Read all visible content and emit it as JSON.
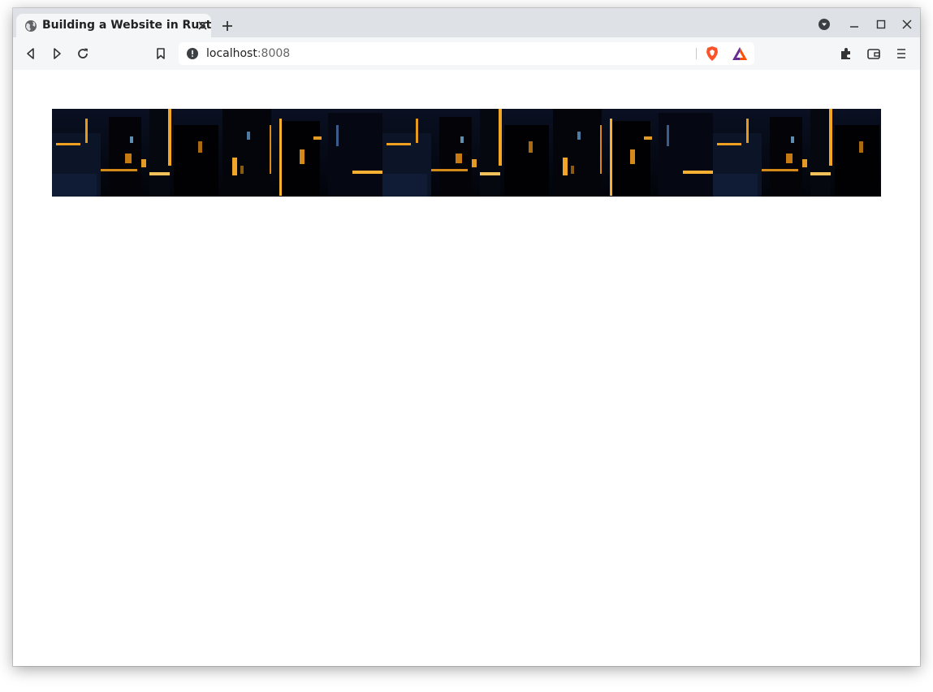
{
  "tab": {
    "title": "Building a Website in Rust",
    "favicon": "globe-icon"
  },
  "toolbar": {
    "url_host": "localhost",
    "url_port": ":8008",
    "back_icon": "back-arrow-icon",
    "forward_icon": "forward-arrow-icon",
    "reload_icon": "reload-icon",
    "bookmark_icon": "bookmark-icon",
    "site_info_icon": "info-icon",
    "shields_icon": "brave-shields-icon",
    "rewards_icon": "brave-rewards-icon",
    "extensions_icon": "puzzle-icon",
    "wallet_icon": "wallet-icon",
    "menu_icon": "hamburger-menu-icon"
  },
  "colors": {
    "tabbar_bg": "#dee1e6",
    "toolbar_bg": "#f5f6f7",
    "banner_dark": "#05060d",
    "banner_light": "#f5a623",
    "brave_orange": "#fb542b"
  }
}
